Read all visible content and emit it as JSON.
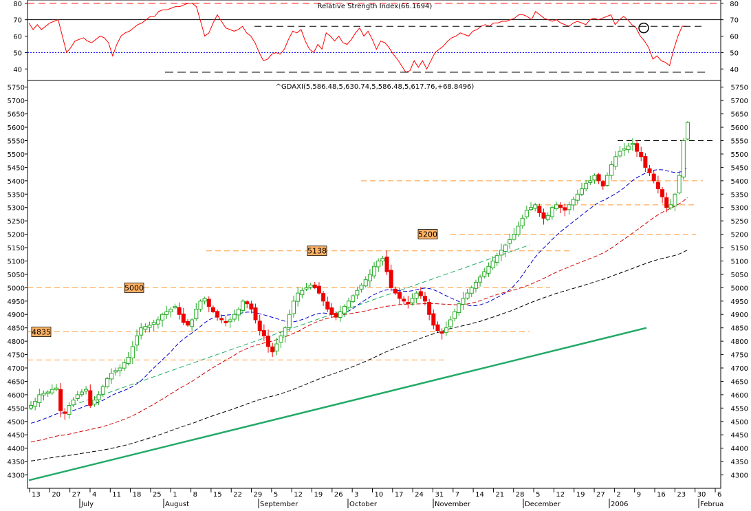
{
  "chart_data": [
    {
      "type": "line",
      "title": "Relative Strength Index(66.1694)",
      "ylim": [
        33,
        82
      ],
      "yticks": [
        40,
        50,
        60,
        70,
        80
      ],
      "reference_levels": [
        {
          "value": 80,
          "style": "dashed",
          "color": "#ff0000"
        },
        {
          "value": 70,
          "style": "solid",
          "color": "#000000"
        },
        {
          "value": 50,
          "style": "dotted",
          "color": "#0000ff"
        }
      ],
      "series": [
        {
          "color": "#ff0000",
          "values": [
            68,
            64,
            67,
            64,
            66,
            68,
            69,
            70,
            60,
            50,
            53,
            57,
            58,
            59,
            57,
            56,
            58,
            60,
            59,
            56,
            48,
            55,
            60,
            62,
            63,
            65,
            67,
            68,
            70,
            72,
            72,
            75,
            76,
            76,
            77,
            78,
            78,
            79,
            80,
            80,
            78,
            69,
            60,
            62,
            68,
            73,
            69,
            65,
            64,
            63,
            64,
            66,
            62,
            60,
            56,
            50,
            45,
            46,
            49,
            50,
            49,
            52,
            58,
            63,
            62,
            64,
            57,
            52,
            50,
            55,
            52,
            62,
            60,
            57,
            60,
            56,
            55,
            58,
            62,
            65,
            60,
            63,
            58,
            52,
            57,
            56,
            53,
            49,
            46,
            42,
            38,
            39,
            45,
            41,
            45,
            40,
            45,
            50,
            52,
            54,
            57,
            59,
            60,
            62,
            61,
            60,
            63,
            64,
            66,
            67,
            66,
            68,
            68,
            69,
            69,
            70,
            71,
            73,
            73,
            72,
            70,
            75,
            73,
            71,
            70,
            69,
            70,
            68,
            67,
            66,
            68,
            69,
            68,
            67,
            70,
            71,
            70,
            71,
            72,
            73,
            67,
            70,
            72,
            70,
            67,
            65,
            60,
            57,
            53,
            46,
            48,
            45,
            44,
            42,
            52,
            60,
            66,
            66
          ]
        }
      ],
      "annotations": [
        {
          "type": "circle",
          "value": 65
        }
      ],
      "support_lines": [
        {
          "value": 66,
          "style": "dashed"
        },
        {
          "value": 38,
          "style": "dashed"
        }
      ]
    },
    {
      "type": "candlestick",
      "title": "^GDAXI(5,586.48,5,630.74,5,586.48,5,617.76,+68.8496)",
      "ylim": [
        4250,
        5775
      ],
      "yticks": [
        4300,
        4350,
        4400,
        4450,
        4500,
        4550,
        4600,
        4650,
        4700,
        4750,
        4800,
        4850,
        4900,
        4950,
        5000,
        5050,
        5100,
        5150,
        5200,
        5250,
        5300,
        5350,
        5400,
        5450,
        5500,
        5550,
        5600,
        5650,
        5700,
        5750
      ],
      "x_day_labels": [
        "13",
        "20",
        "27",
        "4",
        "11",
        "18",
        "25",
        "1",
        "8",
        "15",
        "22",
        "29",
        "5",
        "12",
        "19",
        "26",
        "3",
        "10",
        "17",
        "24",
        "31",
        "7",
        "14",
        "21",
        "28",
        "5",
        "12",
        "19",
        "27",
        "2",
        "9",
        "16",
        "23",
        "30",
        "6"
      ],
      "x_month_labels": [
        "July",
        "August",
        "September",
        "October",
        "November",
        "December",
        "2006",
        "Februa"
      ],
      "close_values": [
        4560,
        4575,
        4600,
        4605,
        4610,
        4620,
        4625,
        4540,
        4530,
        4560,
        4580,
        4600,
        4610,
        4620,
        4560,
        4580,
        4600,
        4630,
        4660,
        4680,
        4690,
        4700,
        4720,
        4740,
        4780,
        4820,
        4850,
        4855,
        4860,
        4870,
        4880,
        4900,
        4910,
        4920,
        4930,
        4900,
        4870,
        4860,
        4880,
        4920,
        4950,
        4960,
        4930,
        4910,
        4890,
        4880,
        4870,
        4880,
        4900,
        4920,
        4950,
        4940,
        4920,
        4880,
        4840,
        4820,
        4780,
        4760,
        4790,
        4820,
        4850,
        4900,
        4950,
        4980,
        4990,
        5000,
        5010,
        5000,
        4980,
        4950,
        4920,
        4900,
        4890,
        4910,
        4930,
        4950,
        4970,
        4990,
        5010,
        5030,
        5050,
        5080,
        5100,
        5110,
        5060,
        5000,
        4980,
        4960,
        4950,
        4940,
        4960,
        4980,
        4970,
        4950,
        4900,
        4860,
        4840,
        4830,
        4850,
        4880,
        4910,
        4940,
        4960,
        4980,
        5000,
        5020,
        5040,
        5060,
        5080,
        5100,
        5120,
        5140,
        5160,
        5180,
        5200,
        5230,
        5260,
        5290,
        5300,
        5310,
        5280,
        5260,
        5270,
        5300,
        5310,
        5300,
        5290,
        5310,
        5330,
        5350,
        5370,
        5390,
        5400,
        5420,
        5400,
        5380,
        5420,
        5460,
        5490,
        5510,
        5520,
        5530,
        5540,
        5510,
        5490,
        5450,
        5430,
        5400,
        5370,
        5340,
        5300,
        5310,
        5350,
        5420,
        5550,
        5618
      ],
      "sma_series": [
        {
          "name": "",
          "color": "#0000cc",
          "start": 4490,
          "end": 5450
        },
        {
          "name": "",
          "color": "#cc0000",
          "start": 4420,
          "end": 5380
        },
        {
          "name": "",
          "color": "#000000",
          "start": 4350,
          "end": 5230
        }
      ],
      "trendlines": [
        {
          "color": "#22aa66",
          "from": 4280,
          "to": 4850,
          "style": "solid"
        },
        {
          "color": "#22aa66",
          "from": 4560,
          "to": 5160,
          "style": "dashed"
        }
      ],
      "levels": [
        {
          "value": 4835,
          "label": "4835",
          "box": true
        },
        {
          "value": 5000,
          "label": "5000",
          "box": true
        },
        {
          "value": 5138,
          "label": "5138",
          "box": true
        },
        {
          "value": 5200,
          "label": "5200",
          "box": true
        },
        {
          "value": 5400,
          "label": "",
          "box": false
        },
        {
          "value": 5310,
          "label": "",
          "box": false
        },
        {
          "value": 4730,
          "label": "",
          "box": false
        },
        {
          "value": 5550,
          "label": "",
          "box": false
        }
      ],
      "colors": {
        "up": "#22aa22",
        "down": "#ee0000",
        "level": "#ff9933",
        "box": "#ffb366"
      }
    }
  ]
}
